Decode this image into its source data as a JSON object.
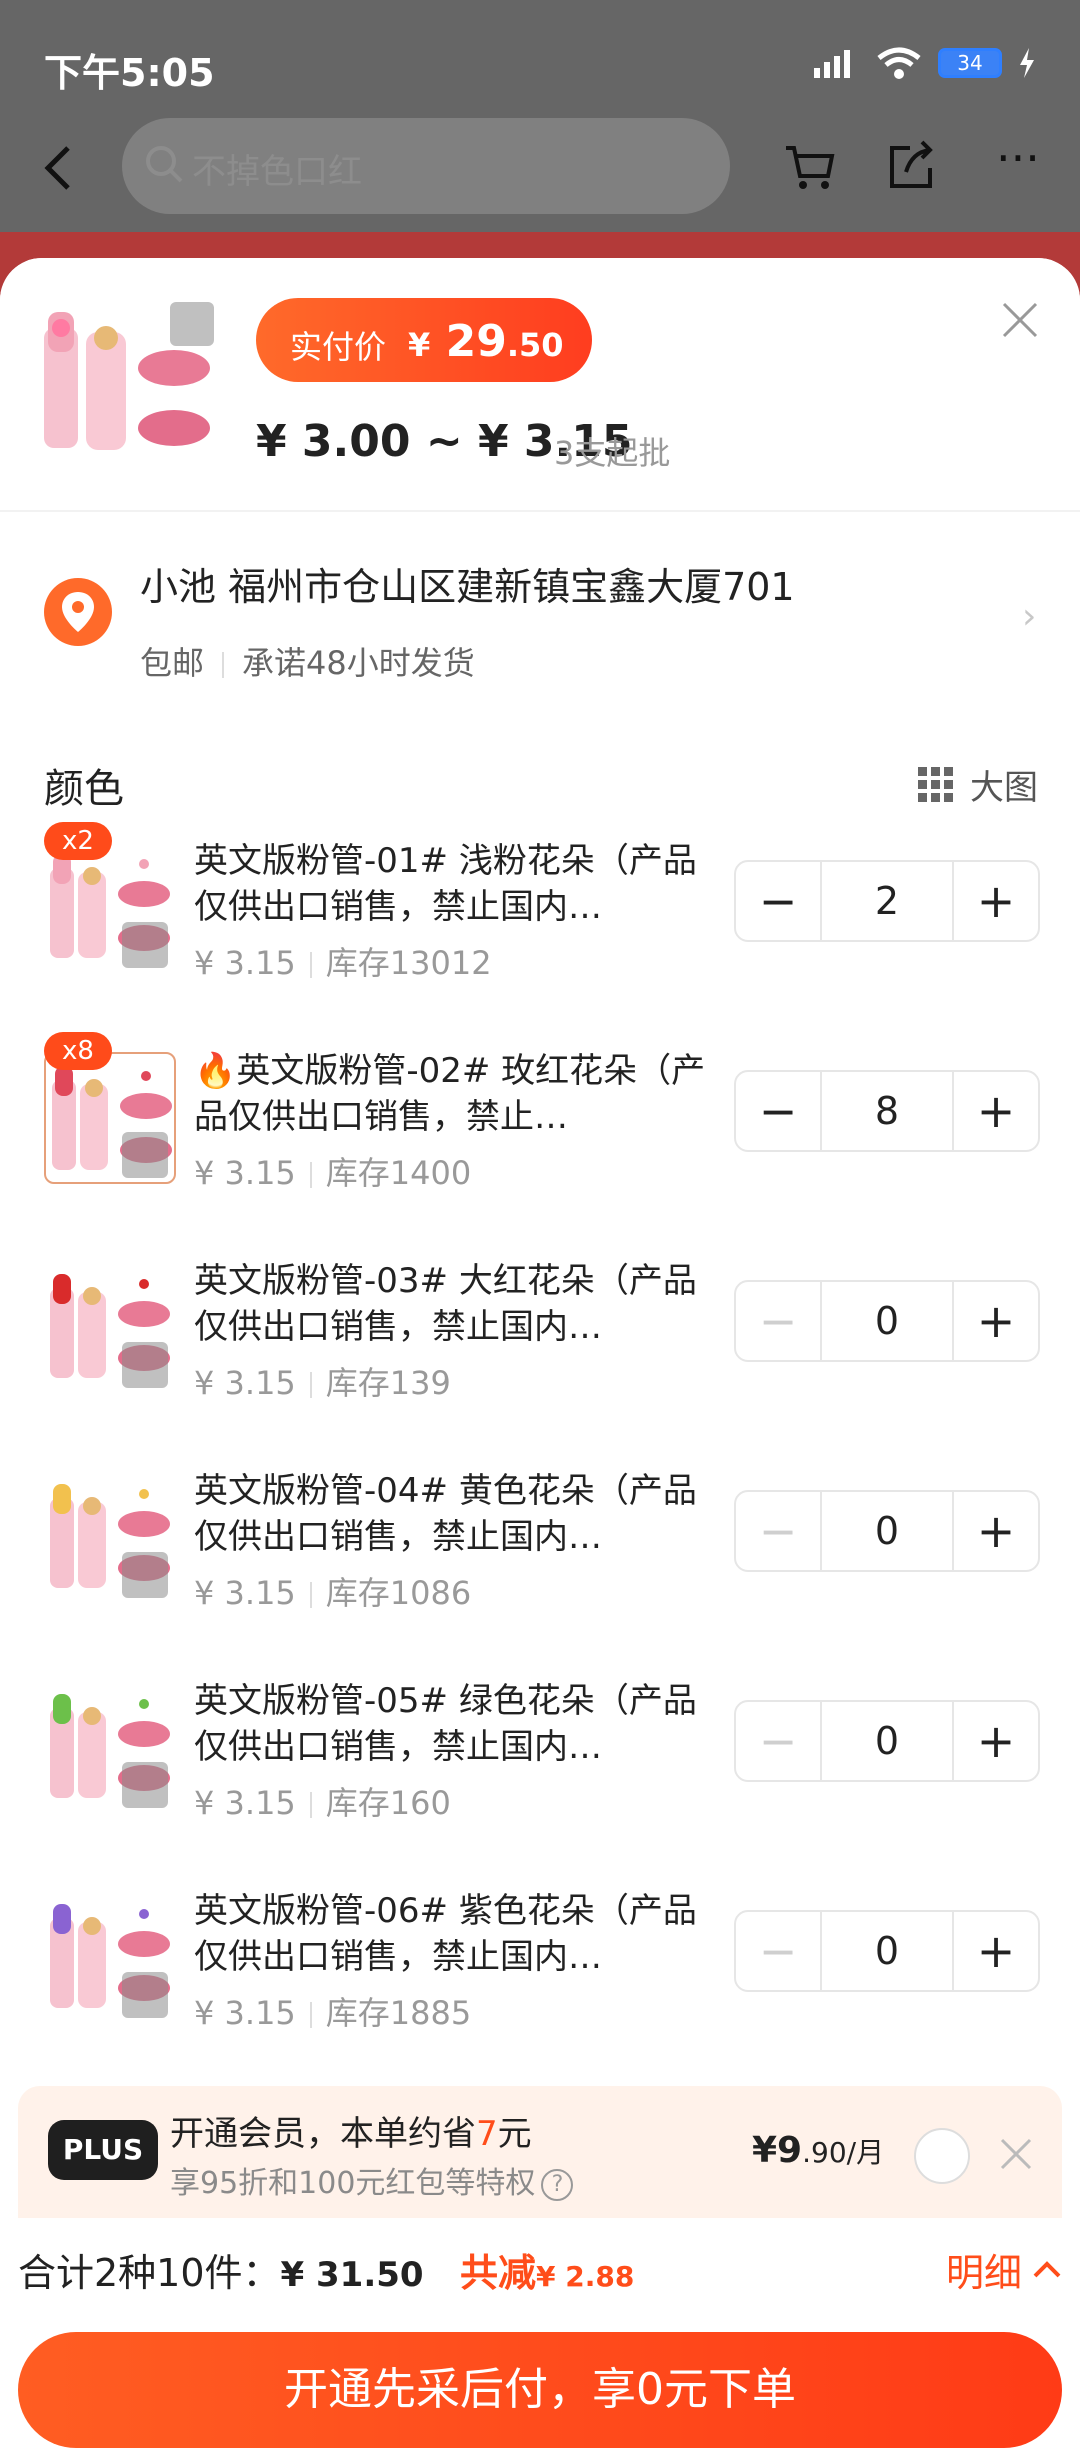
{
  "status_bar": {
    "time": "下午5:05",
    "battery": "34"
  },
  "nav": {
    "search_placeholder": "不掉色口红"
  },
  "product": {
    "pill_label": "实付价",
    "pill_currency": "¥",
    "pill_price_int": "29",
    "pill_price_dec": ".50",
    "range_text": "¥ 3.00 ~ ¥ 3.15",
    "min_order": "3支起批"
  },
  "address": {
    "line": "小池 福州市仓山区建新镇宝鑫大厦701",
    "shipping": "包邮",
    "promise": "承诺48小时发货"
  },
  "color_section": {
    "title": "颜色",
    "big_view": "大图",
    "items": [
      {
        "name": "英文版粉管-01# 浅粉花朵（产品仅供出口销售，禁止国内…",
        "price": "¥ 3.15",
        "stock": "库存13012",
        "qty": "2",
        "badge": "x2",
        "accent": "#f2a3b6",
        "selected": false
      },
      {
        "name": "🔥英文版粉管-02# 玫红花朵（产品仅供出口销售，禁止…",
        "price": "¥ 3.15",
        "stock": "库存1400",
        "qty": "8",
        "badge": "x8",
        "accent": "#e0485a",
        "selected": true
      },
      {
        "name": "英文版粉管-03# 大红花朵（产品仅供出口销售，禁止国内…",
        "price": "¥ 3.15",
        "stock": "库存139",
        "qty": "0",
        "badge": "",
        "accent": "#d92b2b",
        "selected": false
      },
      {
        "name": "英文版粉管-04# 黄色花朵（产品仅供出口销售，禁止国内…",
        "price": "¥ 3.15",
        "stock": "库存1086",
        "qty": "0",
        "badge": "",
        "accent": "#f2c14e",
        "selected": false
      },
      {
        "name": "英文版粉管-05# 绿色花朵（产品仅供出口销售，禁止国内…",
        "price": "¥ 3.15",
        "stock": "库存160",
        "qty": "0",
        "badge": "",
        "accent": "#6cc04a",
        "selected": false
      },
      {
        "name": "英文版粉管-06# 紫色花朵（产品仅供出口销售，禁止国内…",
        "price": "¥ 3.15",
        "stock": "库存1885",
        "qty": "0",
        "badge": "",
        "accent": "#8a63d2",
        "selected": false
      }
    ]
  },
  "plus": {
    "logo": "PLUS",
    "title_prefix": "开通会员，本单约省",
    "title_amount": "7",
    "title_suffix": "元",
    "subtitle": "享95折和100元红包等特权",
    "price_int": "¥9",
    "price_dec": ".90/月"
  },
  "footer": {
    "total_label": "合计2种10件：",
    "total_amount": "¥ 31.50",
    "discount_label": "共减",
    "discount_amount": "¥ 2.88",
    "detail": "明细",
    "cta": "开通先采后付，享0元下单"
  },
  "colors": {
    "accent": "#ff4d1a",
    "brand_gradient_start": "#ff6a2a",
    "brand_gradient_end": "#ff3d1f"
  }
}
